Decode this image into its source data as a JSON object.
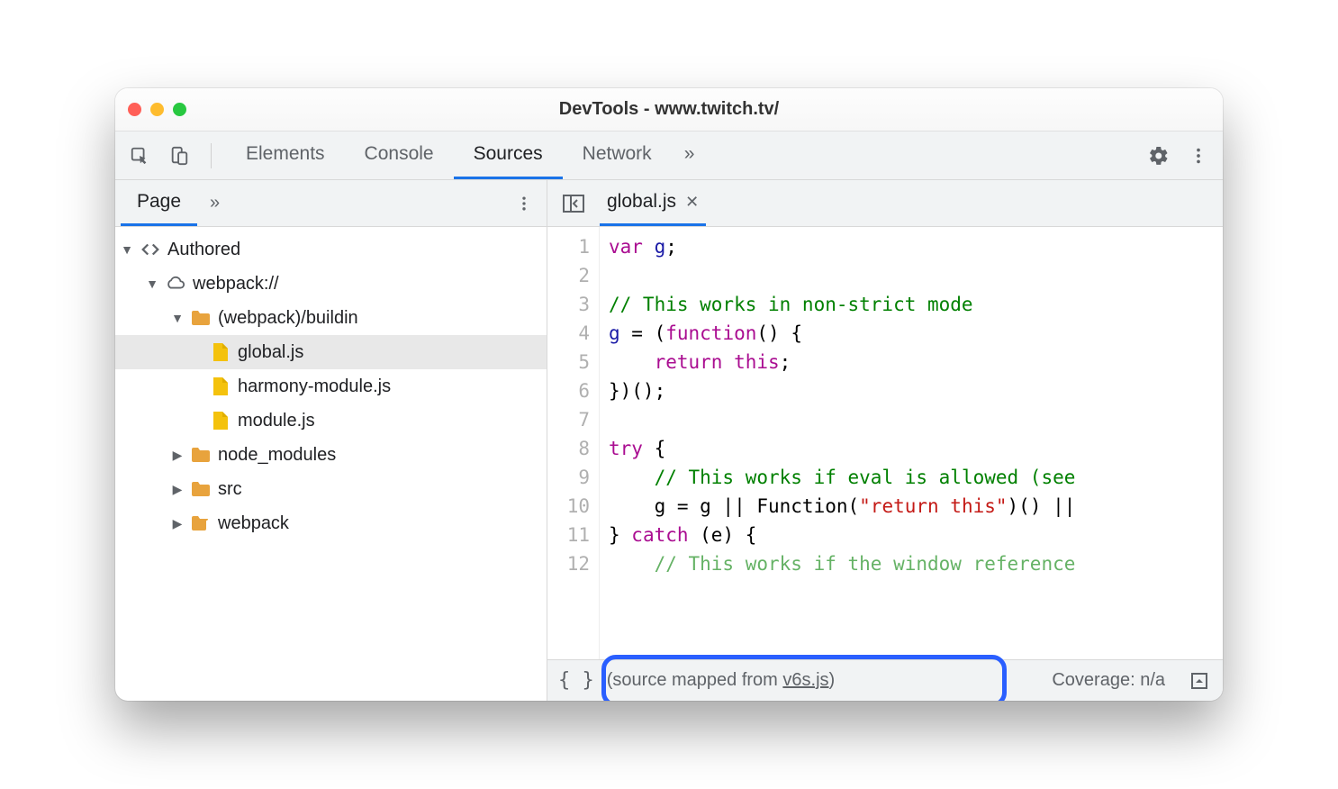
{
  "titlebar": {
    "title": "DevTools - www.twitch.tv/"
  },
  "main_tabs": {
    "items": [
      "Elements",
      "Console",
      "Sources",
      "Network"
    ],
    "active": "Sources",
    "overflow_glyph": "»"
  },
  "left_panel": {
    "tab": "Page",
    "overflow_glyph": "»",
    "tree": {
      "root": "Authored",
      "webpack_label": "webpack://",
      "buildin_label": "(webpack)/buildin",
      "files": [
        "global.js",
        "harmony-module.js",
        "module.js"
      ],
      "folders": [
        "node_modules",
        "src",
        "webpack"
      ]
    }
  },
  "editor": {
    "open_tab": "global.js",
    "gutter": [
      "1",
      "2",
      "3",
      "4",
      "5",
      "6",
      "7",
      "8",
      "9",
      "10",
      "11",
      "12"
    ],
    "code": {
      "l1_var": "var",
      "l1_g": "g",
      "l1_semi": ";",
      "l3_comment": "// This works in non-strict mode",
      "l4_g": "g",
      "l4_eq": " = (",
      "l4_func": "function",
      "l4_rest": "() {",
      "l5_return": "return",
      "l5_this": "this",
      "l5_semi": ";",
      "l6": "})();",
      "l8_try": "try",
      "l8_brace": " {",
      "l9_comment": "// This works if eval is allowed (see",
      "l10_pre": "    g = g || Function(",
      "l10_str": "\"return this\"",
      "l10_post": ")() ||",
      "l11_brace": "} ",
      "l11_catch": "catch",
      "l11_e": " (e) {",
      "l12_comment": "// This works if the window reference"
    }
  },
  "statusbar": {
    "pretty": "{ }",
    "mapped_prefix": "(source mapped from ",
    "mapped_link": "v6s.js",
    "mapped_suffix": ")",
    "coverage": "Coverage: n/a"
  }
}
